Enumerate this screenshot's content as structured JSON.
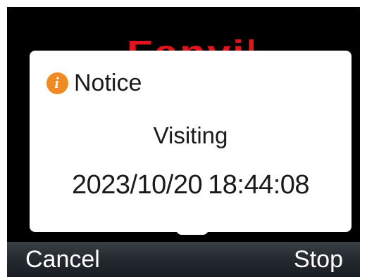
{
  "brand": {
    "logo_text": "Fanvil"
  },
  "dialog": {
    "icon": "info-icon",
    "title": "Notice",
    "status": "Visiting",
    "date": "2023/10/20",
    "time": "18:44:08"
  },
  "softkeys": {
    "left_label": "Cancel",
    "right_label": "Stop"
  },
  "colors": {
    "screen_background": "#000000",
    "dialog_background": "#ffffff",
    "info_icon": "#f08a24",
    "logo": "#e0141c",
    "softkey_bar": "#2a2f35"
  }
}
